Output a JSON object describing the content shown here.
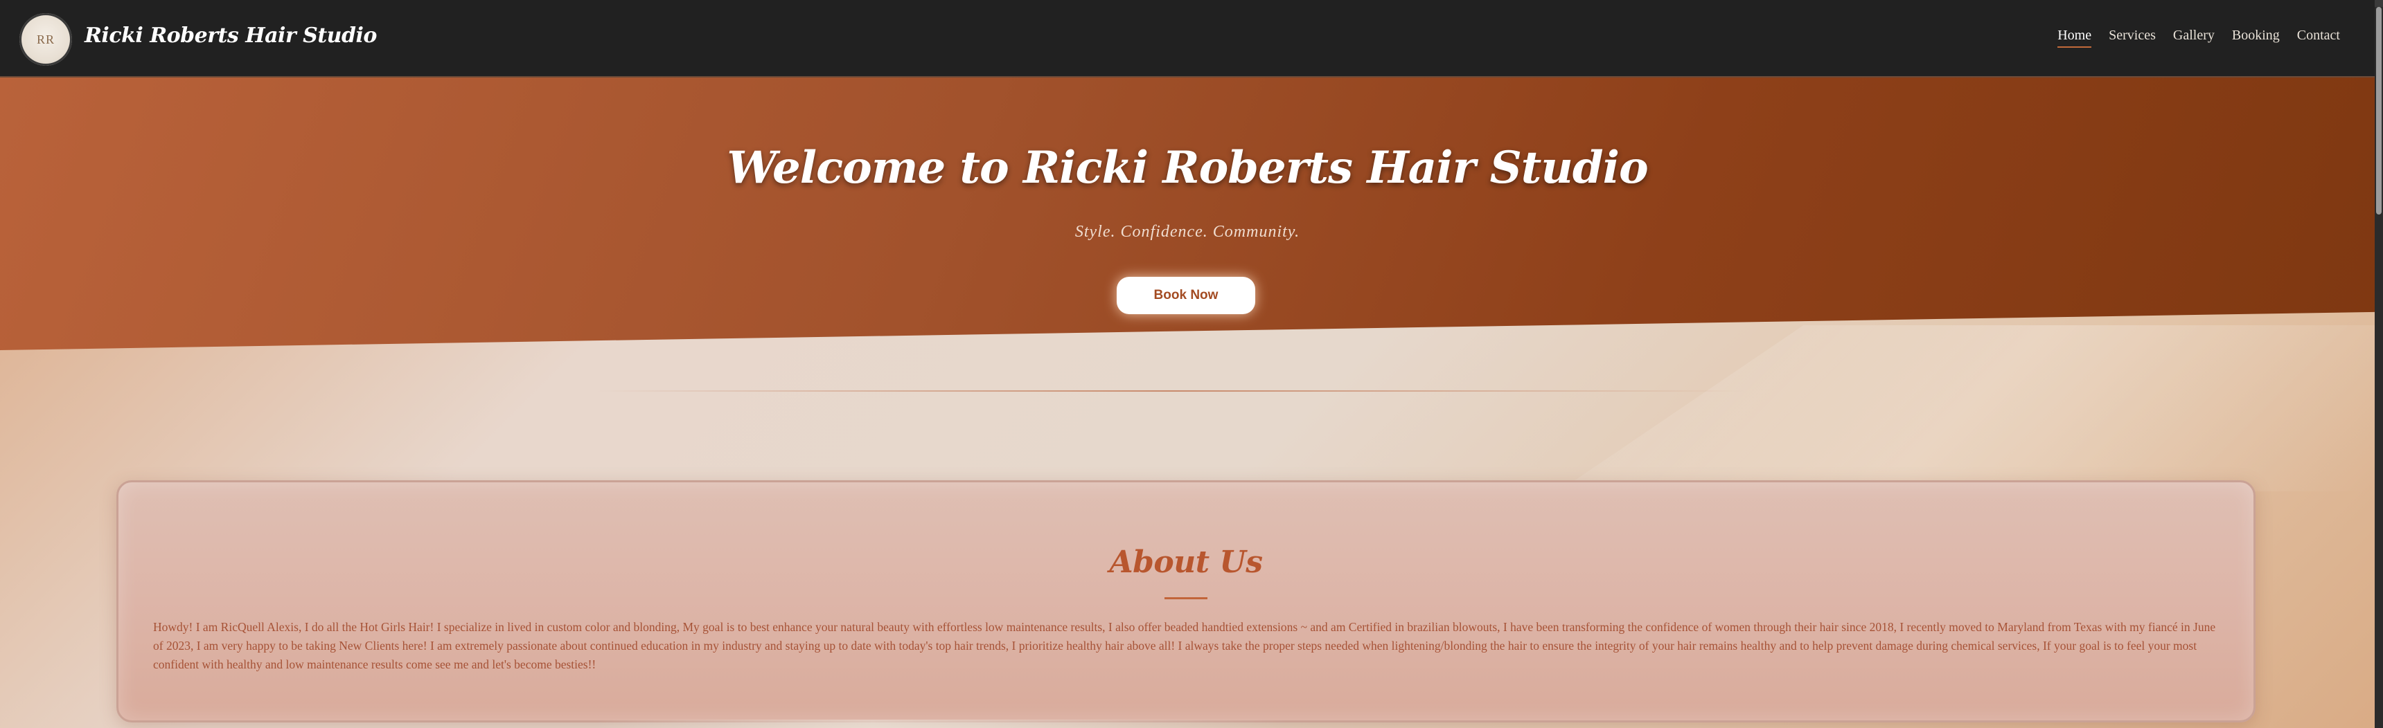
{
  "nav": {
    "logo_text": "RR",
    "brand": "Ricki Roberts Hair Studio",
    "links": [
      "Home",
      "Services",
      "Gallery",
      "Booking",
      "Contact"
    ],
    "active": "Home"
  },
  "hero": {
    "title": "Welcome to Ricki Roberts Hair Studio",
    "subtitle": "Style. Confidence. Community.",
    "cta": "Book Now"
  },
  "about": {
    "title": "About Us",
    "text": "Howdy! I am RicQuell Alexis, I do all the Hot Girls Hair! I specialize in lived in custom color and blonding, My goal is to best enhance your natural beauty with effortless low maintenance results, I also offer beaded handtied extensions ~ and am Certified in brazilian blowouts, I have been transforming the confidence of women through their hair since 2018, I recently moved to Maryland from Texas with my fiancé in June of 2023, I am very happy to be taking New Clients here! I am extremely passionate about continued education in my industry and staying up to date with today's top hair trends, I prioritize healthy hair above all! I always take the proper steps needed when lightening/blonding the hair to ensure the integrity of your hair remains healthy and to help prevent damage during chemical services, If your goal is to feel your most confident with healthy and low maintenance results come see me and let's become besties!!"
  },
  "colors": {
    "nav_bg": "#212121",
    "hero_start": "#b9623a",
    "hero_end": "#7f3811",
    "accent": "#b8562e"
  }
}
